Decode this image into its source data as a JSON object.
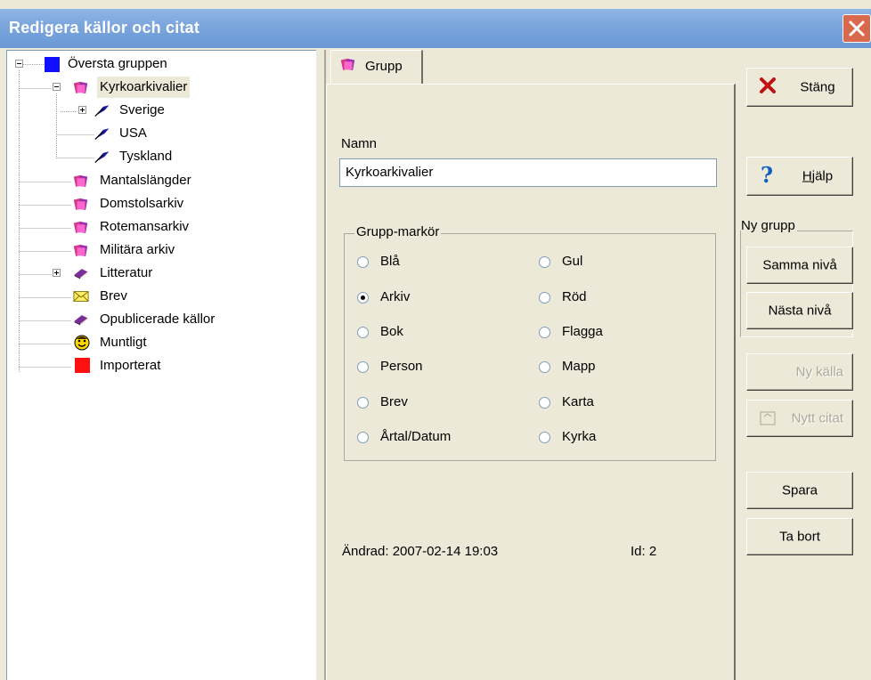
{
  "window": {
    "title": "Redigera källor och citat"
  },
  "tree": {
    "items": [
      {
        "label": "Översta gruppen",
        "icon": "blue-square-icon"
      },
      {
        "label": "Kyrkoarkivalier",
        "icon": "books-icon"
      },
      {
        "label": "Sverige",
        "icon": "quill-icon"
      },
      {
        "label": "USA",
        "icon": "quill-icon"
      },
      {
        "label": "Tyskland",
        "icon": "quill-icon"
      },
      {
        "label": "Mantalslängder",
        "icon": "books-icon"
      },
      {
        "label": "Domstolsarkiv",
        "icon": "books-icon"
      },
      {
        "label": "Rotemansarkiv",
        "icon": "books-icon"
      },
      {
        "label": "Militära arkiv",
        "icon": "books-icon"
      },
      {
        "label": "Litteratur",
        "icon": "book-icon"
      },
      {
        "label": "Brev",
        "icon": "envelope-icon"
      },
      {
        "label": "Opublicerade källor",
        "icon": "book-icon"
      },
      {
        "label": "Muntligt",
        "icon": "face-icon"
      },
      {
        "label": "Importerat",
        "icon": "red-square-icon"
      }
    ]
  },
  "tab": {
    "label": "Grupp"
  },
  "form": {
    "name_label": "Namn",
    "name_value": "Kyrkoarkivalier",
    "markers_title": "Grupp-markör",
    "markers": [
      {
        "label": "Blå",
        "checked": false
      },
      {
        "label": "Gul",
        "checked": false
      },
      {
        "label": "Arkiv",
        "checked": true
      },
      {
        "label": "Röd",
        "checked": false
      },
      {
        "label": "Bok",
        "checked": false
      },
      {
        "label": "Flagga",
        "checked": false
      },
      {
        "label": "Person",
        "checked": false
      },
      {
        "label": "Mapp",
        "checked": false
      },
      {
        "label": "Brev",
        "checked": false
      },
      {
        "label": "Karta",
        "checked": false
      },
      {
        "label": "Årtal/Datum",
        "checked": false
      },
      {
        "label": "Kyrka",
        "checked": false
      }
    ],
    "changed": "Ändrad: 2007-02-14 19:03",
    "id_label": "Id:  2"
  },
  "buttons": {
    "close": "Stäng",
    "help": "Hjälp",
    "ny_grupp_title": "Ny grupp",
    "same_level": "Samma nivå",
    "next_level": "Nästa nivå",
    "new_source": "Ny källa",
    "new_citation": "Nytt citat",
    "save": "Spara",
    "delete": "Ta bort"
  },
  "colors": {
    "titlebar": "#7aa5dd",
    "close_red": "#d9694d",
    "face": "#ece9d8"
  }
}
